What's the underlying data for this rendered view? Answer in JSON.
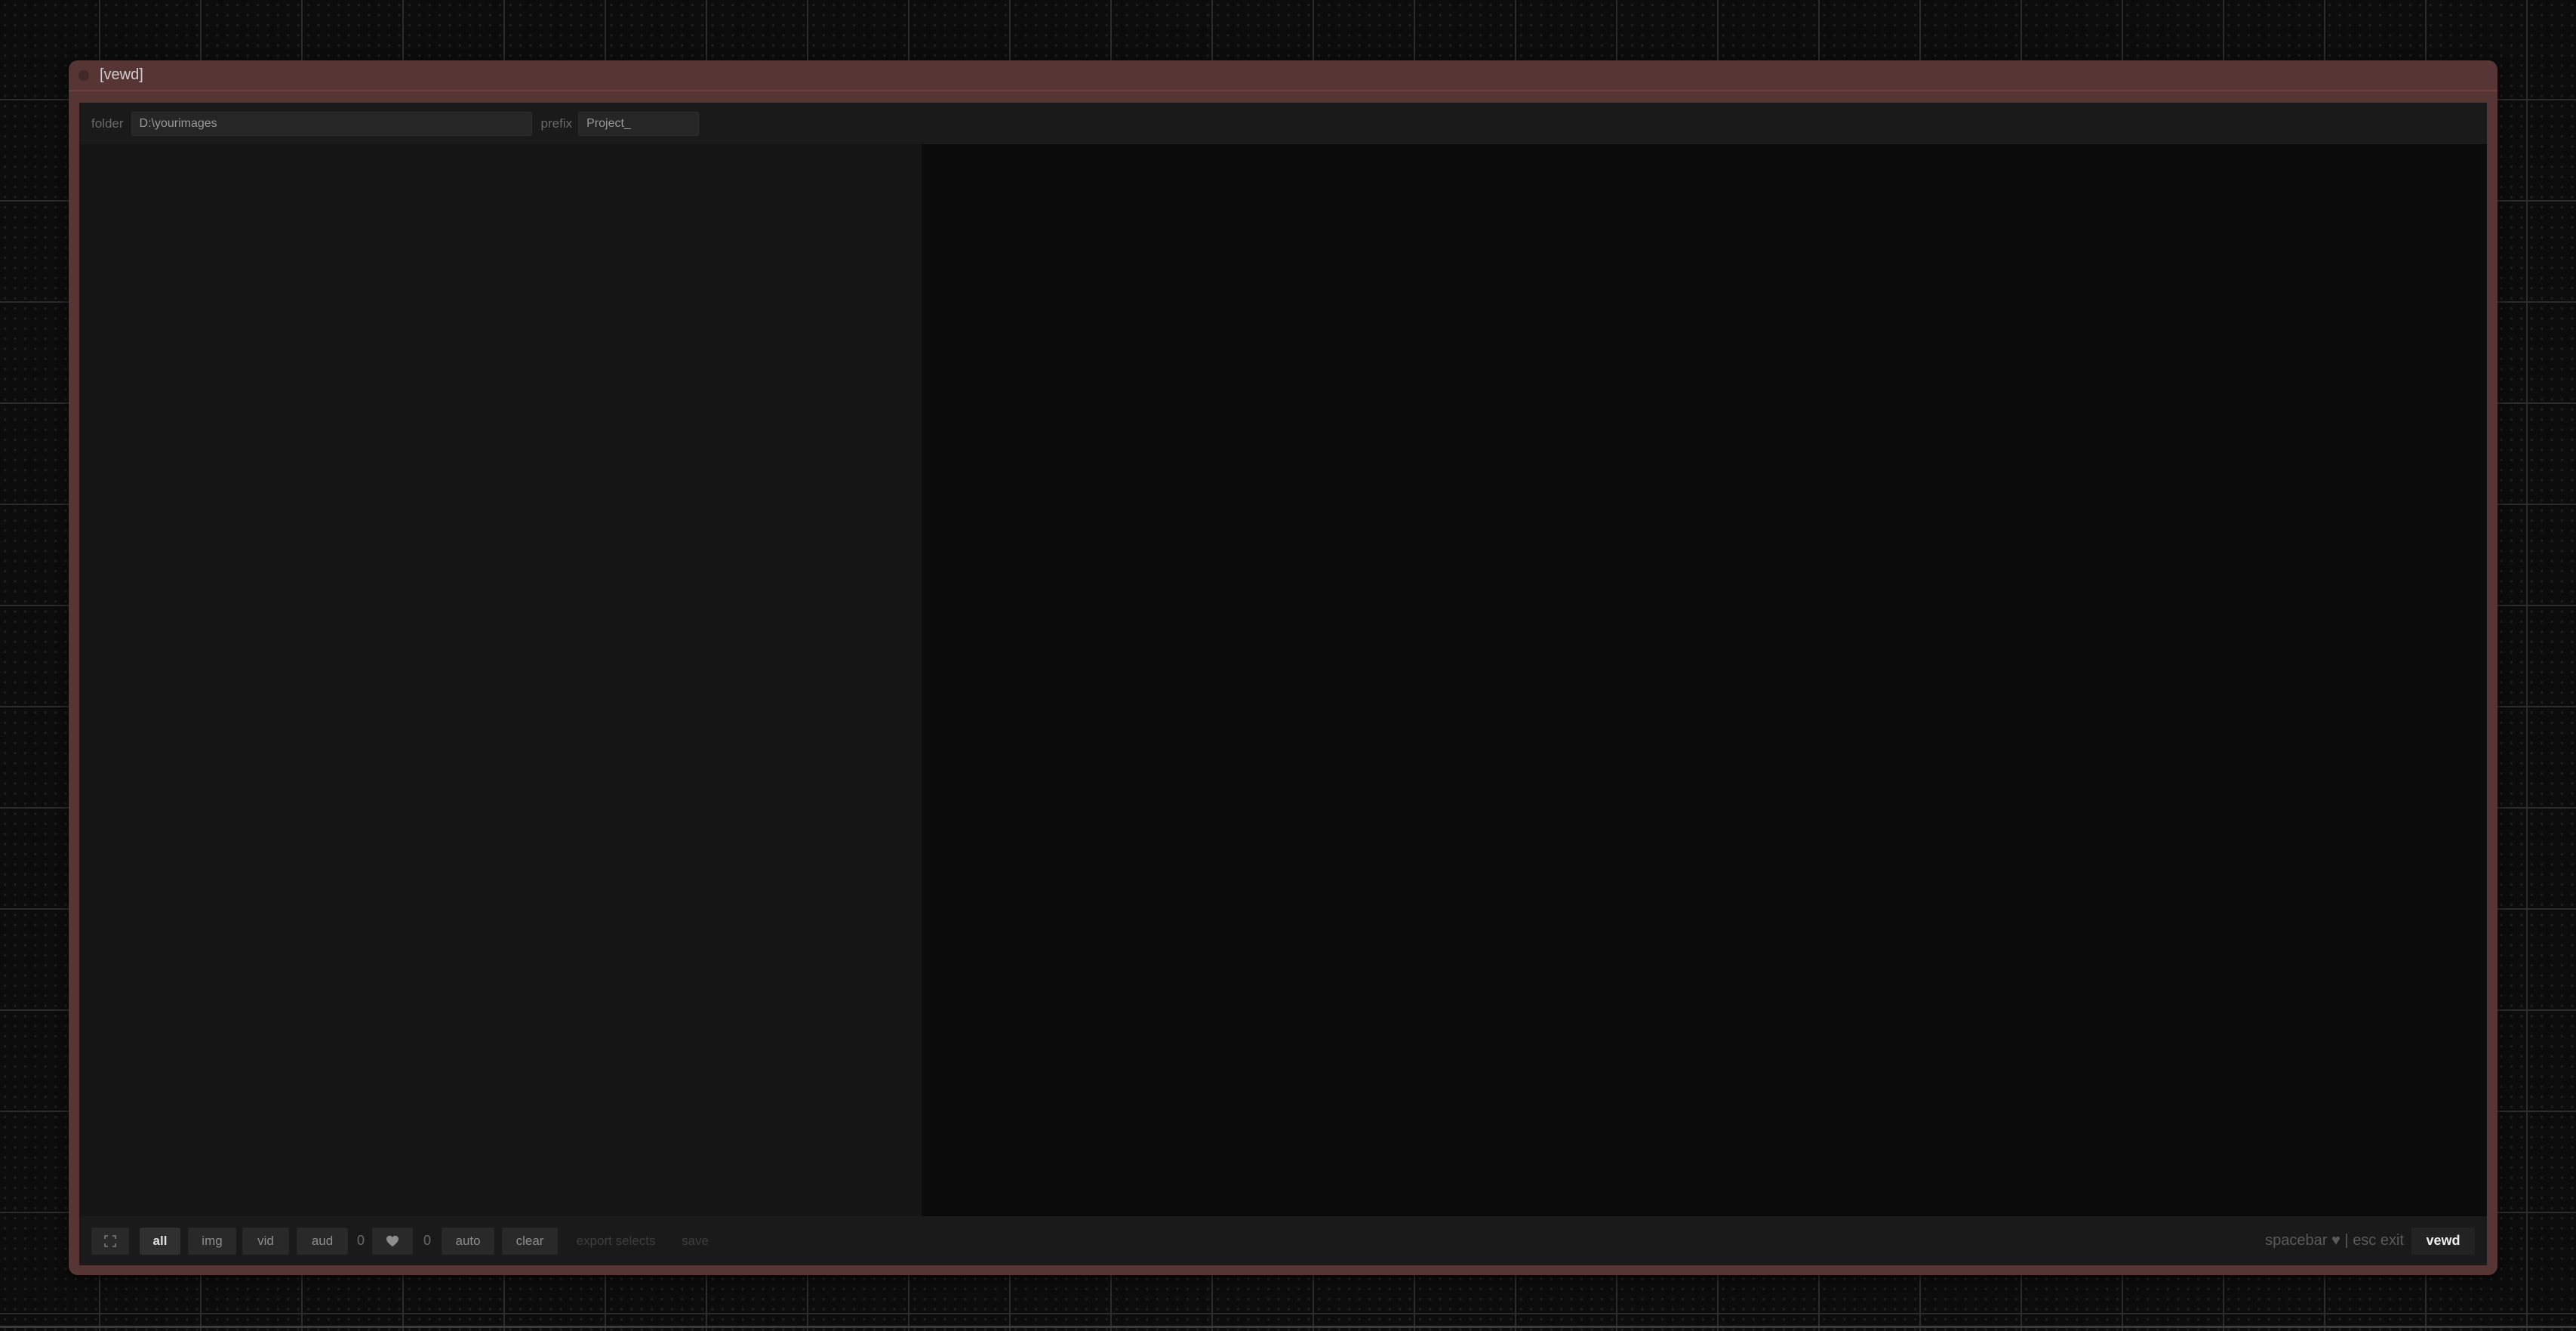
{
  "node": {
    "title": "[vewd]",
    "title_color": "#583535"
  },
  "topbar": {
    "folder_label": "folder",
    "folder_value": "D:\\yourimages",
    "prefix_label": "prefix",
    "prefix_value": "Project_"
  },
  "bottombar": {
    "fullscreen_icon": "expand-icon",
    "filters": {
      "all": "all",
      "img": "img",
      "vid": "vid",
      "aud": "aud"
    },
    "selected_count": "0",
    "favorite_icon": "heart-icon",
    "favorite_count": "0",
    "auto_label": "auto",
    "clear_label": "clear",
    "export_label": "export selects",
    "save_label": "save",
    "hint_text": "spacebar ♥ | esc exit",
    "vewd_label": "vewd"
  }
}
